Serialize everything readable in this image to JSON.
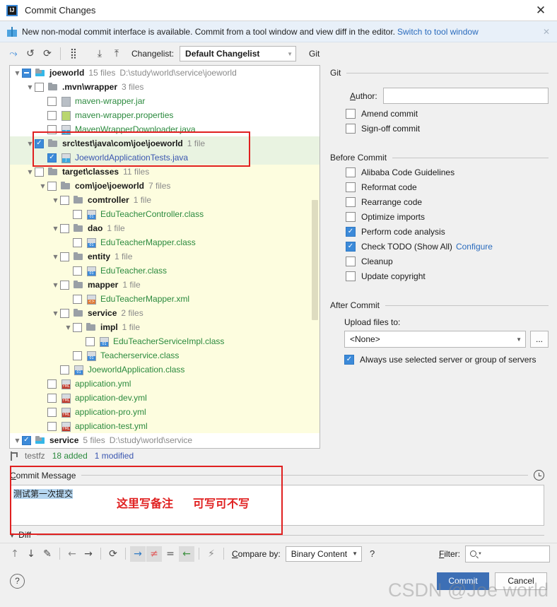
{
  "window": {
    "title": "Commit Changes",
    "close_label": "✕",
    "app_icon": "IJ"
  },
  "notification": {
    "icon": "gift-icon",
    "text": "New non-modal commit interface is available. Commit from a tool window and view diff in the editor.",
    "link": "Switch to tool window",
    "close": "✕"
  },
  "toolbar": {
    "buttons": [
      {
        "name": "include-in-commit-icon",
        "glyph": "⤳"
      },
      {
        "name": "rollback-icon",
        "glyph": "↺"
      },
      {
        "name": "refresh-icon",
        "glyph": "⟳"
      },
      {
        "name": "group-by-icon",
        "glyph": "⣿"
      },
      {
        "name": "expand-all-icon",
        "glyph": "⤓"
      },
      {
        "name": "collapse-all-icon",
        "glyph": "⤒"
      }
    ],
    "changelist_label": "Changelist:",
    "changelist_value": "Default Changelist",
    "git_label": "Git"
  },
  "tree": {
    "rows": [
      {
        "indent": 0,
        "arrow": "▼",
        "check": "partial",
        "icon": "folder-mod",
        "name": "joeworld",
        "name_style": "dark bold",
        "meta": "15 files",
        "path": "D:\\study\\world\\service\\joeworld",
        "bg": "white"
      },
      {
        "indent": 1,
        "arrow": "▼",
        "check": "off",
        "icon": "folder",
        "name": ".mvn\\wrapper",
        "name_style": "dark bold",
        "meta": "3 files",
        "path": "",
        "bg": "white"
      },
      {
        "indent": 2,
        "arrow": "",
        "check": "off",
        "icon": "file-jar",
        "name": "maven-wrapper.jar",
        "name_style": "green",
        "meta": "",
        "path": "",
        "bg": "white"
      },
      {
        "indent": 2,
        "arrow": "",
        "check": "off",
        "icon": "file-props",
        "name": "maven-wrapper.properties",
        "name_style": "green",
        "meta": "",
        "path": "",
        "bg": "white"
      },
      {
        "indent": 2,
        "arrow": "",
        "check": "off",
        "icon": "file-java",
        "name": "MavenWrapperDownloader.java",
        "name_style": "green",
        "meta": "",
        "path": "",
        "bg": "white"
      },
      {
        "indent": 1,
        "arrow": "▼",
        "check": "on",
        "icon": "folder",
        "name": "src\\test\\java\\com\\joe\\joeworld",
        "name_style": "dark bold",
        "meta": "1 file",
        "path": "",
        "bg": "green"
      },
      {
        "indent": 2,
        "arrow": "",
        "check": "on",
        "icon": "file-java",
        "name": "JoeworldApplicationTests.java",
        "name_style": "blue",
        "meta": "",
        "path": "",
        "bg": "green"
      },
      {
        "indent": 1,
        "arrow": "▼",
        "check": "off",
        "icon": "folder",
        "name": "target\\classes",
        "name_style": "dark bold",
        "meta": "11 files",
        "path": "",
        "bg": "yellow"
      },
      {
        "indent": 2,
        "arrow": "▼",
        "check": "off",
        "icon": "folder",
        "name": "com\\joe\\joeworld",
        "name_style": "dark bold",
        "meta": "7 files",
        "path": "",
        "bg": "yellow"
      },
      {
        "indent": 3,
        "arrow": "▼",
        "check": "off",
        "icon": "folder",
        "name": "comtroller",
        "name_style": "dark bold",
        "meta": "1 file",
        "path": "",
        "bg": "yellow"
      },
      {
        "indent": 4,
        "arrow": "",
        "check": "off",
        "icon": "file-cls",
        "name": "EduTeacherController.class",
        "name_style": "green",
        "meta": "",
        "path": "",
        "bg": "yellow"
      },
      {
        "indent": 3,
        "arrow": "▼",
        "check": "off",
        "icon": "folder",
        "name": "dao",
        "name_style": "dark bold",
        "meta": "1 file",
        "path": "",
        "bg": "yellow"
      },
      {
        "indent": 4,
        "arrow": "",
        "check": "off",
        "icon": "file-cls",
        "name": "EduTeacherMapper.class",
        "name_style": "green",
        "meta": "",
        "path": "",
        "bg": "yellow"
      },
      {
        "indent": 3,
        "arrow": "▼",
        "check": "off",
        "icon": "folder",
        "name": "entity",
        "name_style": "dark bold",
        "meta": "1 file",
        "path": "",
        "bg": "yellow"
      },
      {
        "indent": 4,
        "arrow": "",
        "check": "off",
        "icon": "file-cls",
        "name": "EduTeacher.class",
        "name_style": "green",
        "meta": "",
        "path": "",
        "bg": "yellow"
      },
      {
        "indent": 3,
        "arrow": "▼",
        "check": "off",
        "icon": "folder",
        "name": "mapper",
        "name_style": "dark bold",
        "meta": "1 file",
        "path": "",
        "bg": "yellow"
      },
      {
        "indent": 4,
        "arrow": "",
        "check": "off",
        "icon": "file-xml",
        "name": "EduTeacherMapper.xml",
        "name_style": "green",
        "meta": "",
        "path": "",
        "bg": "yellow"
      },
      {
        "indent": 3,
        "arrow": "▼",
        "check": "off",
        "icon": "folder",
        "name": "service",
        "name_style": "dark bold",
        "meta": "2 files",
        "path": "",
        "bg": "yellow"
      },
      {
        "indent": 4,
        "arrow": "▼",
        "check": "off",
        "icon": "folder",
        "name": "impl",
        "name_style": "dark bold",
        "meta": "1 file",
        "path": "",
        "bg": "yellow"
      },
      {
        "indent": 5,
        "arrow": "",
        "check": "off",
        "icon": "file-cls",
        "name": "EduTeacherServiceImpl.class",
        "name_style": "green",
        "meta": "",
        "path": "",
        "bg": "yellow"
      },
      {
        "indent": 4,
        "arrow": "",
        "check": "off",
        "icon": "file-cls",
        "name": "Teacherservice.class",
        "name_style": "green",
        "meta": "",
        "path": "",
        "bg": "yellow"
      },
      {
        "indent": 3,
        "arrow": "",
        "check": "off",
        "icon": "file-cls",
        "name": "JoeworldApplication.class",
        "name_style": "green",
        "meta": "",
        "path": "",
        "bg": "yellow"
      },
      {
        "indent": 2,
        "arrow": "",
        "check": "off",
        "icon": "file-yml",
        "name": "application.yml",
        "name_style": "green",
        "meta": "",
        "path": "",
        "bg": "yellow"
      },
      {
        "indent": 2,
        "arrow": "",
        "check": "off",
        "icon": "file-yml",
        "name": "application-dev.yml",
        "name_style": "green",
        "meta": "",
        "path": "",
        "bg": "yellow"
      },
      {
        "indent": 2,
        "arrow": "",
        "check": "off",
        "icon": "file-yml",
        "name": "application-pro.yml",
        "name_style": "green",
        "meta": "",
        "path": "",
        "bg": "yellow"
      },
      {
        "indent": 2,
        "arrow": "",
        "check": "off",
        "icon": "file-yml",
        "name": "application-test.yml",
        "name_style": "green",
        "meta": "",
        "path": "",
        "bg": "yellow"
      },
      {
        "indent": 0,
        "arrow": "▼",
        "check": "on",
        "icon": "folder-mod",
        "name": "service",
        "name_style": "dark bold",
        "meta": "5 files",
        "path": "D:\\study\\world\\service",
        "bg": "white"
      }
    ]
  },
  "branch_status": {
    "icon": "branch-icon",
    "name": "testfz",
    "added": "18 added",
    "modified": "1 modified"
  },
  "git_section": {
    "title": "Git",
    "author_label": "Author:",
    "author_value": "",
    "author_placeholder": "",
    "checkboxes": [
      {
        "label": "Amend commit",
        "checked": false,
        "name": "amend-commit-checkbox"
      },
      {
        "label": "Sign-off commit",
        "checked": false,
        "name": "sign-off-commit-checkbox"
      }
    ]
  },
  "before_commit": {
    "title": "Before Commit",
    "checkboxes": [
      {
        "label": "Alibaba Code Guidelines",
        "checked": false,
        "link": "",
        "name": "alibaba-code-guidelines-checkbox"
      },
      {
        "label": "Reformat code",
        "checked": false,
        "link": "",
        "name": "reformat-code-checkbox"
      },
      {
        "label": "Rearrange code",
        "checked": false,
        "link": "",
        "name": "rearrange-code-checkbox"
      },
      {
        "label": "Optimize imports",
        "checked": false,
        "link": "",
        "name": "optimize-imports-checkbox"
      },
      {
        "label": "Perform code analysis",
        "checked": true,
        "link": "",
        "name": "perform-code-analysis-checkbox"
      },
      {
        "label": "Check TODO (Show All)",
        "checked": true,
        "link": "Configure",
        "name": "check-todo-checkbox"
      },
      {
        "label": "Cleanup",
        "checked": false,
        "link": "",
        "name": "cleanup-checkbox"
      },
      {
        "label": "Update copyright",
        "checked": false,
        "link": "",
        "name": "update-copyright-checkbox"
      }
    ]
  },
  "after_commit": {
    "title": "After Commit",
    "upload_label": "Upload files to:",
    "upload_value": "<None>",
    "browse_label": "...",
    "always_use_label": "Always use selected server or group of servers",
    "always_use_checked": true
  },
  "commit_message": {
    "title": "Commit Message",
    "value": "测试第一次提交",
    "history_icon": "clock-icon",
    "annotation_1": "这里写备注",
    "annotation_2": "可写可不写"
  },
  "diff": {
    "label": "Diff",
    "arrow": "▼",
    "toolbar": [
      {
        "name": "previous-difference-icon",
        "glyph": "↑",
        "style": ""
      },
      {
        "name": "next-difference-icon",
        "glyph": "↓",
        "style": "dark"
      },
      {
        "name": "edit-source-icon",
        "glyph": "✎",
        "style": "dark"
      },
      {
        "name": "previous-file-icon",
        "glyph": "←",
        "style": ""
      },
      {
        "name": "next-file-icon",
        "glyph": "→",
        "style": "dark"
      },
      {
        "name": "refresh-diff-icon",
        "glyph": "⟳",
        "style": "dark"
      },
      {
        "name": "accept-right-icon",
        "glyph": "→",
        "style": "active bluec"
      },
      {
        "name": "show-difference-icon",
        "glyph": "≠",
        "style": "active redc"
      },
      {
        "name": "equal-icon",
        "glyph": "=",
        "style": "dark"
      },
      {
        "name": "accept-left-icon",
        "glyph": "←",
        "style": "active greenc"
      },
      {
        "name": "ignore-whitespace-icon",
        "glyph": "⚡",
        "style": ""
      }
    ],
    "compare_by_label": "Compare by:",
    "compare_by_value": "Binary Content",
    "help_glyph": "?",
    "filter_label": "Filter:",
    "filter_value": "",
    "filter_icon": "search-icon"
  },
  "footer": {
    "help_label": "?",
    "commit_label": "Commit",
    "cancel_label": "Cancel"
  },
  "watermark": "CSDN @Joe world",
  "colors": {
    "accent": "#3c8ad9",
    "primary_button": "#3d6fb5",
    "annotation_red": "#e02020",
    "added_green": "#2b8a3e",
    "modified_blue": "#3a56b0",
    "row_highlight_green": "#e9f3e1",
    "row_highlight_yellow": "#fdfddf"
  }
}
